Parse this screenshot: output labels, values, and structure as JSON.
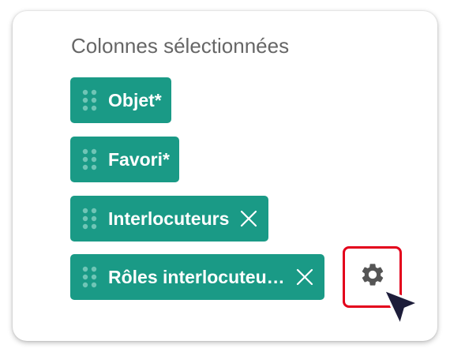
{
  "panel": {
    "title": "Colonnes sélectionnées",
    "chips": [
      {
        "label": "Objet*",
        "removable": false
      },
      {
        "label": "Favori*",
        "removable": false
      },
      {
        "label": "Interlocuteurs",
        "removable": true,
        "close_icon": "close-icon"
      },
      {
        "label": "Rôles interlocuteu…",
        "removable": true,
        "close_icon": "close-icon"
      }
    ],
    "settings": {
      "icon": "gear-icon",
      "highlight_color": "#e3001b"
    }
  },
  "colors": {
    "chip_bg": "#1a9a86",
    "chip_text": "#ffffff",
    "heading_text": "#666666",
    "gear": "#555555",
    "cursor": "#1d1d3a"
  },
  "icons": {
    "drag": "drag-handle-icon",
    "close": "close-icon",
    "settings": "gear-icon",
    "pointer": "mouse-pointer-icon"
  }
}
